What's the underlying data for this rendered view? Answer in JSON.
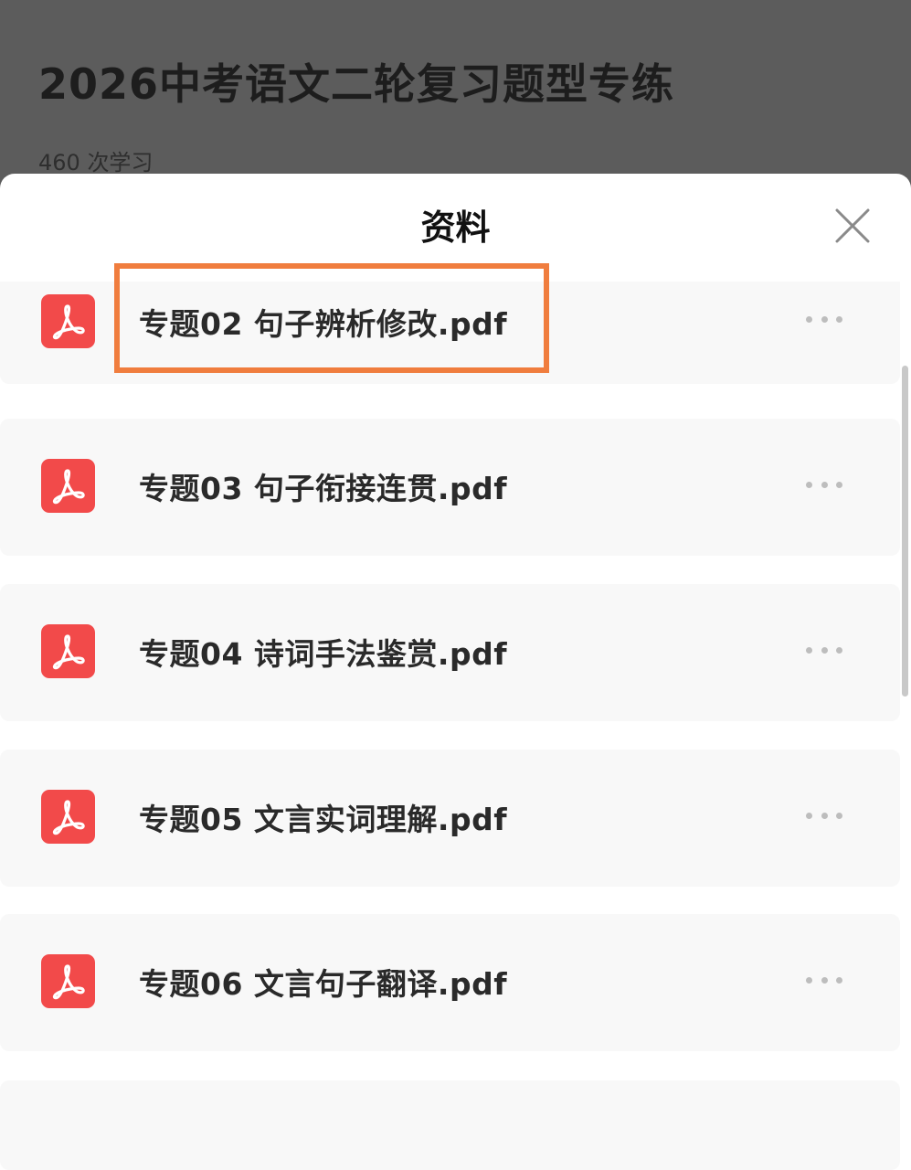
{
  "background": {
    "course_title": "2026中考语文二轮复习题型专练",
    "study_count": "460 次学习"
  },
  "sheet": {
    "title": "资料",
    "close_icon": "close-icon",
    "files": [
      {
        "name": "专题02 句子辨析修改.pdf",
        "icon": "pdf-icon",
        "highlighted": true
      },
      {
        "name": "专题03 句子衔接连贯.pdf",
        "icon": "pdf-icon",
        "highlighted": false
      },
      {
        "name": "专题04 诗词手法鉴赏.pdf",
        "icon": "pdf-icon",
        "highlighted": false
      },
      {
        "name": "专题05 文言实词理解.pdf",
        "icon": "pdf-icon",
        "highlighted": false
      },
      {
        "name": "专题06 文言句子翻译.pdf",
        "icon": "pdf-icon",
        "highlighted": false
      }
    ]
  },
  "colors": {
    "pdf_red": "#f24a4a",
    "highlight_orange": "#f07d3e",
    "overlay_dim": "#5c5c5c"
  }
}
